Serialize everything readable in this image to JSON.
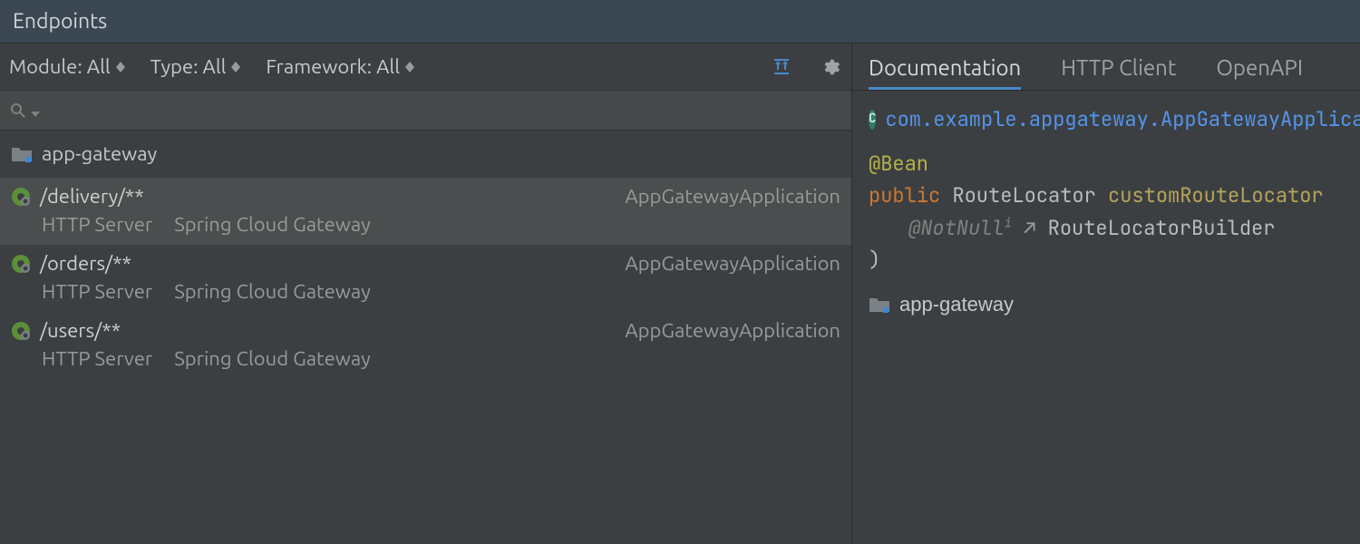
{
  "title": "Endpoints",
  "filters": {
    "module_label": "Module: All",
    "type_label": "Type: All",
    "framework_label": "Framework: All"
  },
  "search": {
    "placeholder": ""
  },
  "tree": {
    "module": "app-gateway",
    "endpoints": [
      {
        "path": "/delivery/**",
        "app": "AppGatewayApplication",
        "sub1": "HTTP Server",
        "sub2": "Spring Cloud Gateway",
        "selected": true
      },
      {
        "path": "/orders/**",
        "app": "AppGatewayApplication",
        "sub1": "HTTP Server",
        "sub2": "Spring Cloud Gateway",
        "selected": false
      },
      {
        "path": "/users/**",
        "app": "AppGatewayApplication",
        "sub1": "HTTP Server",
        "sub2": "Spring Cloud Gateway",
        "selected": false
      }
    ]
  },
  "tabs": [
    {
      "label": "Documentation",
      "active": true
    },
    {
      "label": "HTTP Client",
      "active": false
    },
    {
      "label": "OpenAPI",
      "active": false
    }
  ],
  "doc": {
    "class_badge": "C",
    "fqn": "com.example.appgateway.AppGatewayApplication",
    "line1_anno": "@Bean",
    "line2_kw": "public",
    "line2_type": "RouteLocator",
    "line2_name": "customRouteLocator",
    "line3_anno": "@NotNull",
    "line3_sup": "i",
    "line3_arrow": "↗",
    "line3_type": "RouteLocatorBuilder",
    "line4": ")",
    "module": "app-gateway"
  }
}
